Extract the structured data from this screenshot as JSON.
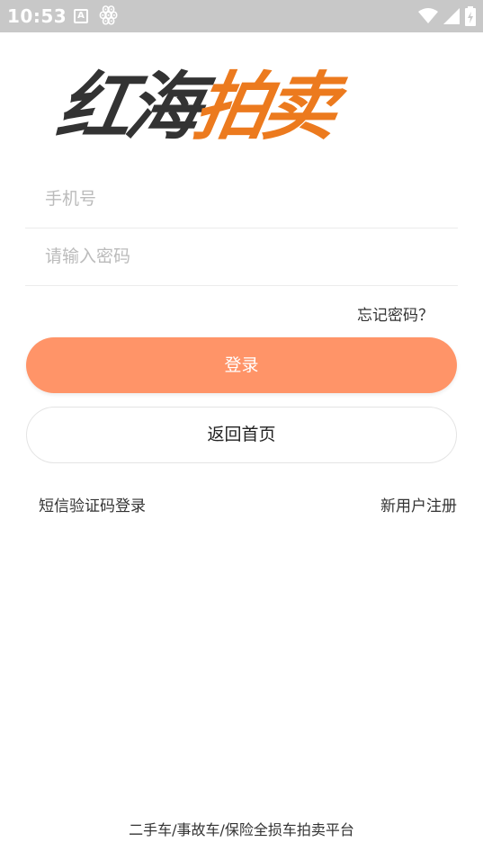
{
  "status_bar": {
    "time": "10:53",
    "icons": [
      "notification-a-icon",
      "bug-icon",
      "wifi-icon",
      "signal-icon",
      "battery-icon"
    ]
  },
  "logo": {
    "part1": "红海",
    "part2": "拍卖",
    "colors": {
      "dark": "#333333",
      "accent": "#ec7a1e"
    }
  },
  "form": {
    "phone_placeholder": "手机号",
    "phone_value": "",
    "password_placeholder": "请输入密码",
    "password_value": "",
    "forgot_label": "忘记密码？",
    "login_label": "登录",
    "home_label": "返回首页",
    "sms_login_label": "短信验证码登录",
    "register_label": "新用户注册"
  },
  "colors": {
    "login_button": "#ff9468",
    "status_bar": "#c8c8c8"
  },
  "footer": {
    "tagline": "二手车/事故车/保险全损车拍卖平台"
  }
}
